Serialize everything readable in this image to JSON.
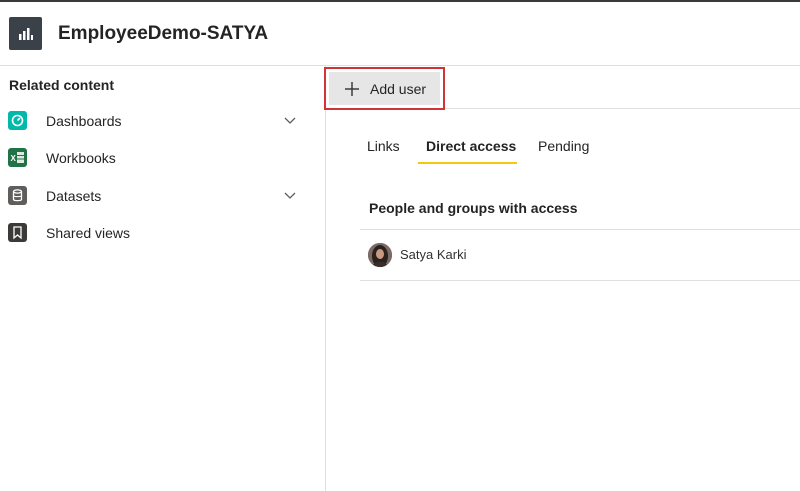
{
  "header": {
    "title": "EmployeeDemo-SATYA",
    "icon": "report-bar-chart-icon"
  },
  "sidebar": {
    "heading": "Related content",
    "items": [
      {
        "label": "Dashboards",
        "icon": "dashboard-icon",
        "color": "#01b8aa",
        "expandable": true
      },
      {
        "label": "Workbooks",
        "icon": "excel-workbook-icon",
        "color": "#217346",
        "expandable": false
      },
      {
        "label": "Datasets",
        "icon": "dataset-icon",
        "color": "#605e5c",
        "expandable": true
      },
      {
        "label": "Shared views",
        "icon": "bookmark-icon",
        "color": "#3b3a39",
        "expandable": false
      }
    ]
  },
  "toolbar": {
    "add_user_label": "Add user"
  },
  "tabs": [
    {
      "label": "Links",
      "active": false
    },
    {
      "label": "Direct access",
      "active": true
    },
    {
      "label": "Pending",
      "active": false
    }
  ],
  "access": {
    "heading": "People and groups with access",
    "people": [
      {
        "name": "Satya Karki"
      }
    ]
  },
  "colors": {
    "accent_tab": "#f2c811",
    "highlight_border": "#d13438",
    "button_bg": "#e6e6e6"
  }
}
